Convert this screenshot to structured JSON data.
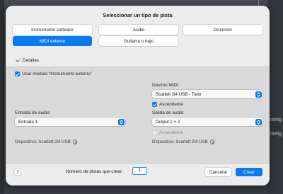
{
  "background": {
    "right_labels": [
      "Intelig",
      "Intelig"
    ]
  },
  "dialog": {
    "title": "Seleccionar un tipo de pista",
    "track_types": [
      {
        "label": "Instrumento software",
        "selected": false
      },
      {
        "label": "Audio",
        "selected": false
      },
      {
        "label": "Drummer",
        "selected": false
      },
      {
        "label": "MIDI externo",
        "selected": true
      },
      {
        "label": "Guitarra o bajo",
        "selected": false
      }
    ],
    "details_label": "Detalles",
    "use_external_instrument": {
      "label": "Usar módulo “Instrumento externo”",
      "checked": true
    },
    "midi_destination": {
      "label": "Destino MIDI:",
      "value": "Scarlett 2i4 USB - Todo",
      "ascending": {
        "label": "Ascendente",
        "checked": true
      }
    },
    "audio_input": {
      "label": "Entrada de audio:",
      "value": "Entrada 1",
      "device_text": "Dispositivo: Scarlett 2i4 USB"
    },
    "audio_output": {
      "label": "Salida de audio:",
      "value": "Output 1 + 2",
      "ascending": {
        "label": "Ascendente",
        "checked": false
      },
      "device_text": "Dispositivo: Scarlett 2i4 USB"
    },
    "footer": {
      "help": "?",
      "count_label": "Número de pistas que crear:",
      "count_value": "1",
      "cancel_label": "Cancelar",
      "create_label": "Crear"
    }
  },
  "colors": {
    "accent": "#0a7af0",
    "dialog_bg": "#ececec",
    "panel_bg": "#d9d9d9"
  }
}
